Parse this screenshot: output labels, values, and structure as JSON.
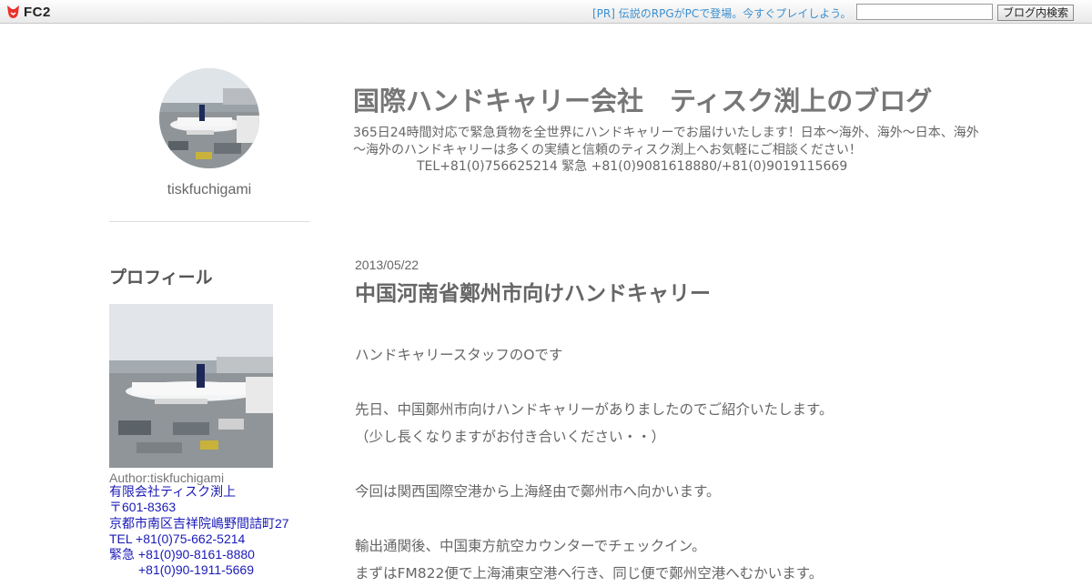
{
  "topbar": {
    "logo_text": "FC2",
    "pr_text": "[PR] 伝説のRPGがPCで登場。今すぐプレイしよう。",
    "search_value": "",
    "search_button": "ブログ内検索"
  },
  "sidebar": {
    "username": "tiskfuchigami",
    "profile_heading": "プロフィール",
    "author": "Author:tiskfuchigami",
    "company": "有限会社ティスク渕上",
    "postal": "〒601-8363",
    "address": "京都市南区吉祥院嶋野間詰町27",
    "tel": "TEL +81(0)75-662-5214",
    "emergency1": "緊急 +81(0)90-8161-8880",
    "emergency2": "+81(0)90-1911-5669"
  },
  "header": {
    "title": "国際ハンドキャリー会社　ティスク渕上のブログ",
    "description": "365日24時間対応で緊急貨物を全世界にハンドキャリーでお届けいたします！日本～海外、海外～日本、海外～海外のハンドキャリーは多くの実績と信頼のティスク渕上へお気軽にご相談ください！",
    "tel": "TEL+81(0)756625214 緊急 +81(0)9081618880/+81(0)9019115669"
  },
  "post": {
    "date": "2013/05/22",
    "title": "中国河南省鄭州市向けハンドキャリー",
    "p1": "ハンドキャリースタッフのOです",
    "p2": "先日、中国鄭州市向けハンドキャリーがありましたのでご紹介いたします。",
    "p3": "（少し長くなりますがお付き合いください・・）",
    "p4": "今回は関西国際空港から上海経由で鄭州市へ向かいます。",
    "p5": "輸出通関後、中国東方航空カウンターでチェックイン。",
    "p6": "まずはFM822便で上海浦東空港へ行き、同じ便で鄭州空港へむかいます。"
  }
}
